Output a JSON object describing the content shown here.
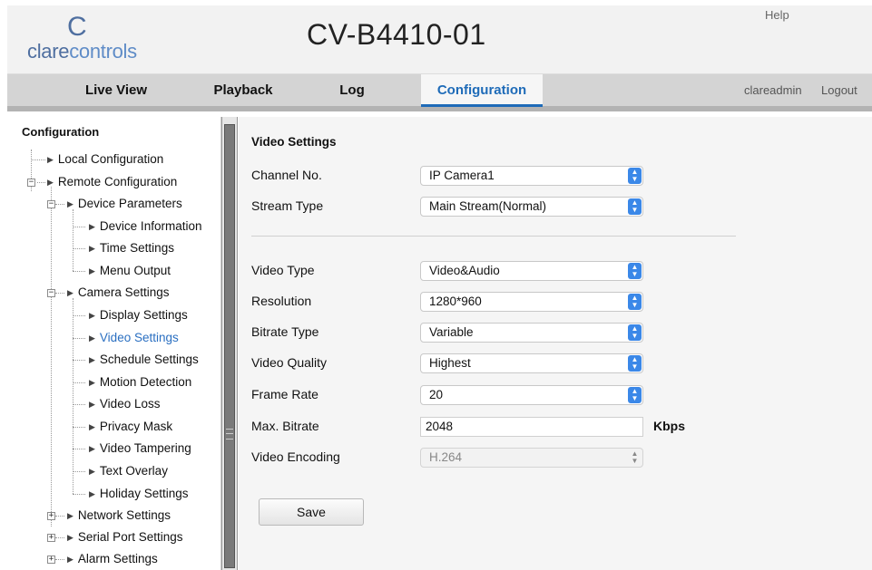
{
  "header": {
    "logo_top": "C",
    "logo_clare": "clare",
    "logo_controls": "controls",
    "device_title": "CV-B4410-01",
    "help": "Help"
  },
  "nav": {
    "tabs": [
      {
        "label": "Live View"
      },
      {
        "label": "Playback"
      },
      {
        "label": "Log"
      },
      {
        "label": "Configuration",
        "active": true
      }
    ],
    "user": "clareadmin",
    "logout": "Logout"
  },
  "tree": {
    "title": "Configuration",
    "items": [
      {
        "label": "Local Configuration"
      },
      {
        "label": "Remote Configuration"
      },
      {
        "label": "Device Parameters"
      },
      {
        "label": "Device Information"
      },
      {
        "label": "Time Settings"
      },
      {
        "label": "Menu Output"
      },
      {
        "label": "Camera Settings"
      },
      {
        "label": "Display Settings"
      },
      {
        "label": "Video Settings",
        "active": true
      },
      {
        "label": "Schedule Settings"
      },
      {
        "label": "Motion Detection"
      },
      {
        "label": "Video Loss"
      },
      {
        "label": "Privacy Mask"
      },
      {
        "label": "Video Tampering"
      },
      {
        "label": "Text Overlay"
      },
      {
        "label": "Holiday Settings"
      },
      {
        "label": "Network Settings"
      },
      {
        "label": "Serial Port Settings"
      },
      {
        "label": "Alarm Settings"
      }
    ],
    "expander_minus": "−",
    "expander_plus": "+"
  },
  "form": {
    "section_title": "Video Settings",
    "channel_label": "Channel No.",
    "channel_value": "IP Camera1",
    "stream_label": "Stream Type",
    "stream_value": "Main Stream(Normal)",
    "video_type_label": "Video Type",
    "video_type_value": "Video&Audio",
    "resolution_label": "Resolution",
    "resolution_value": "1280*960",
    "bitrate_type_label": "Bitrate Type",
    "bitrate_type_value": "Variable",
    "quality_label": "Video Quality",
    "quality_value": "Highest",
    "frame_rate_label": "Frame Rate",
    "frame_rate_value": "20",
    "max_bitrate_label": "Max. Bitrate",
    "max_bitrate_value": "2048",
    "max_bitrate_unit": "Kbps",
    "encoding_label": "Video Encoding",
    "encoding_value": "H.264",
    "save_label": "Save"
  },
  "colors": {
    "accent": "#1e6bb8",
    "select_caret": "#3b88e8",
    "logo": "#4f6fa0"
  }
}
